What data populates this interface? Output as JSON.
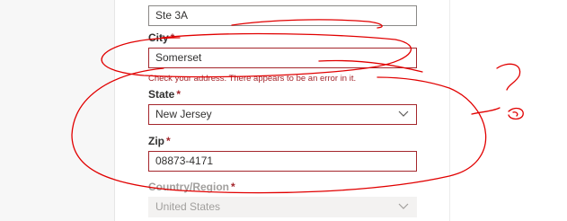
{
  "address": {
    "line2": {
      "value": "Ste 3A"
    },
    "city": {
      "label": "City",
      "required_mark": "*",
      "value": "Somerset",
      "error": "Check your address. There appears to be an error in it."
    },
    "state": {
      "label": "State",
      "required_mark": "*",
      "value": "New Jersey",
      "icon": "chevron-down-icon"
    },
    "zip": {
      "label": "Zip",
      "required_mark": "*",
      "value": "08873-4171"
    },
    "country": {
      "label": "Country/Region",
      "required_mark": "*",
      "value": "United States",
      "icon": "chevron-down-icon",
      "disabled": true
    }
  },
  "colors": {
    "error": "#a4262c",
    "annotation": "#e10000",
    "disabled_bg": "#f3f2f1"
  }
}
